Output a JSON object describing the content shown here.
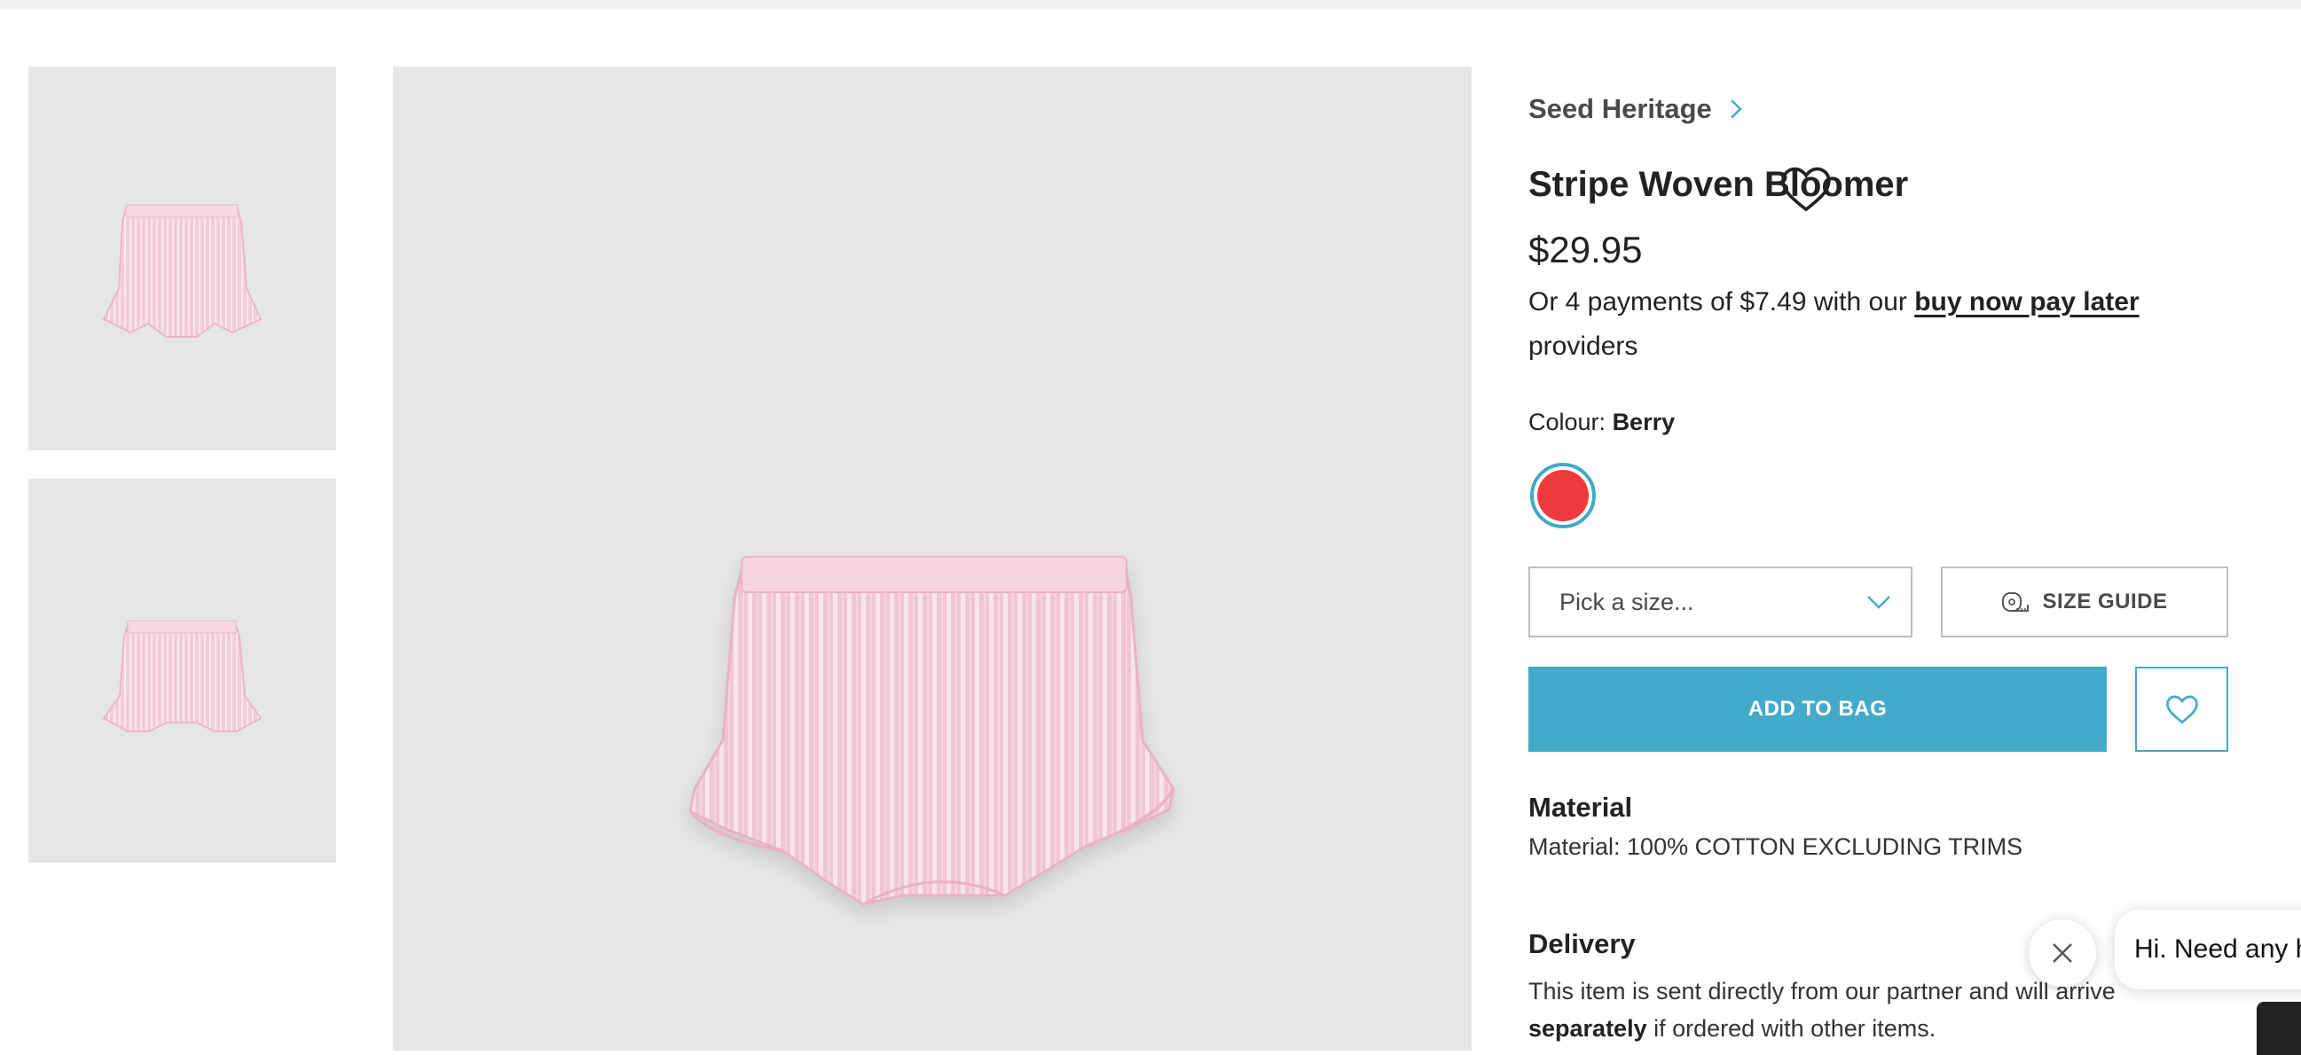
{
  "product": {
    "brand": "Seed Heritage",
    "title": "Stripe Woven Bloomer",
    "price": "$29.95",
    "bnpl_prefix": "Or 4 payments of $7.49 with our ",
    "bnpl_link": "buy now pay later",
    "bnpl_suffix": " providers"
  },
  "colour": {
    "label": "Colour:",
    "value": "Berry",
    "swatch_color": "#ee3a3c"
  },
  "size": {
    "placeholder": "Pick a size...",
    "guide_label": "SIZE GUIDE"
  },
  "actions": {
    "add_to_bag": "ADD TO BAG"
  },
  "material": {
    "heading": "Material",
    "text": "Material: 100% COTTON EXCLUDING TRIMS"
  },
  "delivery": {
    "heading": "Delivery",
    "text_part1": "This item is sent directly from our partner and will arrive ",
    "text_bold": "separately",
    "text_part2": " if ordered with other items."
  },
  "chat": {
    "greeting": "Hi. Need any h"
  },
  "colors": {
    "accent": "#43aac9",
    "garment": "#f1c9d6",
    "image_bg": "#e6e6e6"
  },
  "gallery": {
    "thumbnail_count": 2
  }
}
